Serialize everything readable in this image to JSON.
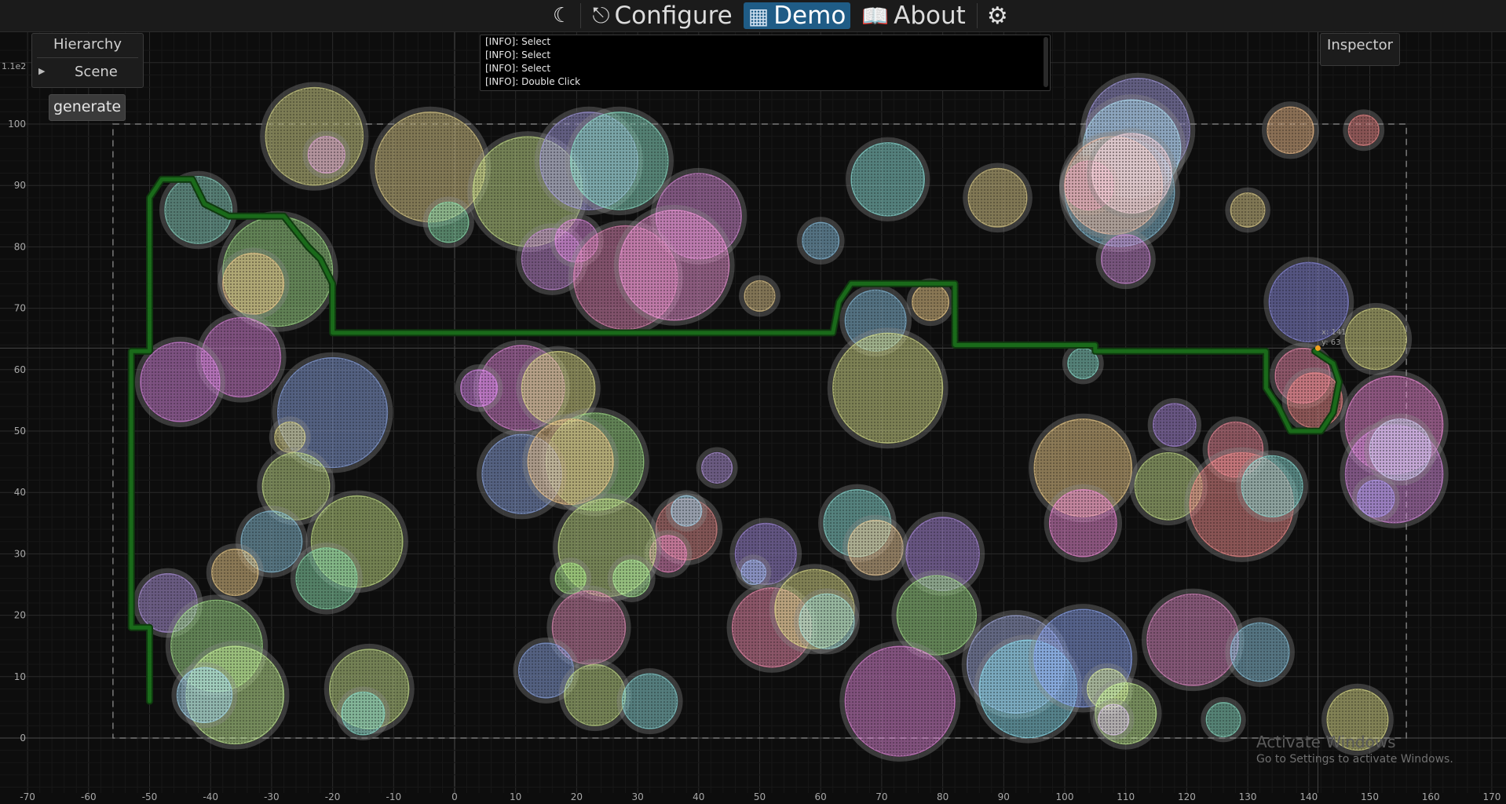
{
  "topbar": {
    "theme_icon": "moon-icon",
    "tabs": [
      {
        "label": "Configure",
        "icon": "hierarchy-icon",
        "active": false
      },
      {
        "label": "Demo",
        "icon": "app-logo-icon",
        "active": true
      },
      {
        "label": "About",
        "icon": "book-icon",
        "active": false
      }
    ],
    "settings_icon": "gear-icon",
    "active_color": "#1f5c86"
  },
  "hierarchy": {
    "title": "Hierarchy",
    "items": [
      {
        "label": "Scene",
        "icon": "collapse-triangle-icon"
      }
    ]
  },
  "generate_label": "generate",
  "inspector": {
    "title": "Inspector"
  },
  "log": {
    "lines": [
      "[INFO]: Select",
      "[INFO]: Select",
      "[INFO]: Select",
      "[INFO]: Double Click"
    ]
  },
  "plot": {
    "y_exponent_label": "1.1e2",
    "x_ticks": [
      -70,
      -60,
      -50,
      -40,
      -30,
      -20,
      -10,
      0,
      10,
      20,
      30,
      40,
      50,
      60,
      70,
      80,
      90,
      100,
      110,
      120,
      130,
      140,
      150,
      160,
      170
    ],
    "y_ticks": [
      0,
      10,
      20,
      30,
      40,
      50,
      60,
      70,
      80,
      90,
      100
    ],
    "bounds_rect": {
      "x": [
        -56,
        156
      ],
      "y": [
        0,
        100
      ]
    },
    "cursor": {
      "x": 141.5,
      "y": 63.5,
      "color": "#f0a020"
    },
    "cursor_readout": {
      "x_text": "x: 141",
      "y_text": "y: 63"
    },
    "path_color": "#1a6a1a",
    "path": [
      [
        -50,
        6
      ],
      [
        -50,
        18
      ],
      [
        -53,
        18
      ],
      [
        -53,
        63
      ],
      [
        -50,
        63
      ],
      [
        -50,
        88
      ],
      [
        -48,
        91
      ],
      [
        -43,
        91
      ],
      [
        -41,
        87
      ],
      [
        -37,
        85
      ],
      [
        -28,
        85
      ],
      [
        -24,
        80
      ],
      [
        -22,
        78
      ],
      [
        -20,
        74
      ],
      [
        -20,
        66
      ],
      [
        62,
        66
      ],
      [
        63,
        71
      ],
      [
        65,
        74
      ],
      [
        82,
        74
      ],
      [
        82,
        64
      ],
      [
        105,
        64
      ],
      [
        105,
        63
      ],
      [
        133,
        63
      ],
      [
        133,
        57
      ],
      [
        135,
        54
      ],
      [
        137,
        50
      ],
      [
        142,
        50
      ],
      [
        144,
        53
      ],
      [
        145,
        58
      ],
      [
        144,
        61
      ],
      [
        141,
        63
      ]
    ],
    "circles": [
      {
        "x": -23,
        "y": 98,
        "r": 8,
        "color": "#d8d990"
      },
      {
        "x": -21,
        "y": 95,
        "r": 3,
        "color": "#e0a8d8"
      },
      {
        "x": -42,
        "y": 86,
        "r": 5.5,
        "color": "#8fd6c4"
      },
      {
        "x": -29,
        "y": 76,
        "r": 9,
        "color": "#a6e08f"
      },
      {
        "x": -33,
        "y": 74,
        "r": 5,
        "color": "#f0c890"
      },
      {
        "x": -35,
        "y": 62,
        "r": 6.5,
        "color": "#d987d8"
      },
      {
        "x": -45,
        "y": 58,
        "r": 6.5,
        "color": "#d98ae0"
      },
      {
        "x": -20,
        "y": 53,
        "r": 9,
        "color": "#8ea6e0"
      },
      {
        "x": -27,
        "y": 49,
        "r": 2.5,
        "color": "#e0d890"
      },
      {
        "x": -26,
        "y": 41,
        "r": 5.5,
        "color": "#c8e08f"
      },
      {
        "x": -16,
        "y": 32,
        "r": 7.5,
        "color": "#c6e08a"
      },
      {
        "x": -30,
        "y": 32,
        "r": 5,
        "color": "#8ec2d8"
      },
      {
        "x": -21,
        "y": 26,
        "r": 5,
        "color": "#90e0b0"
      },
      {
        "x": -36,
        "y": 27,
        "r": 3.8,
        "color": "#f0d090"
      },
      {
        "x": -47,
        "y": 22,
        "r": 4.8,
        "color": "#b59ae0"
      },
      {
        "x": -39,
        "y": 15,
        "r": 7.5,
        "color": "#a6e08f"
      },
      {
        "x": -36,
        "y": 7,
        "r": 8,
        "color": "#c8f09a"
      },
      {
        "x": -41,
        "y": 7,
        "r": 4.5,
        "color": "#a8d8f0"
      },
      {
        "x": -14,
        "y": 8,
        "r": 6.5,
        "color": "#c8e08f"
      },
      {
        "x": -15,
        "y": 4,
        "r": 3.5,
        "color": "#90e0d0"
      },
      {
        "x": -4,
        "y": 93,
        "r": 9,
        "color": "#e0d090"
      },
      {
        "x": -1,
        "y": 84,
        "r": 3.3,
        "color": "#90e0b0"
      },
      {
        "x": 12,
        "y": 89,
        "r": 9,
        "color": "#c8e08f"
      },
      {
        "x": 22,
        "y": 94,
        "r": 8,
        "color": "#a8a0e0"
      },
      {
        "x": 27,
        "y": 94,
        "r": 8,
        "color": "#90e0c8"
      },
      {
        "x": 40,
        "y": 85,
        "r": 7,
        "color": "#d890d8"
      },
      {
        "x": 16,
        "y": 78,
        "r": 5,
        "color": "#c890d8"
      },
      {
        "x": 20,
        "y": 81,
        "r": 3.5,
        "color": "#e090e0"
      },
      {
        "x": 28,
        "y": 75,
        "r": 8.5,
        "color": "#e08ab8"
      },
      {
        "x": 36,
        "y": 77,
        "r": 9,
        "color": "#f09ad8"
      },
      {
        "x": 50,
        "y": 72,
        "r": 2.5,
        "color": "#e0c890"
      },
      {
        "x": 60,
        "y": 81,
        "r": 3,
        "color": "#8ec2e0"
      },
      {
        "x": 71,
        "y": 91,
        "r": 6,
        "color": "#90e0d8"
      },
      {
        "x": 89,
        "y": 88,
        "r": 4.8,
        "color": "#e0d090"
      },
      {
        "x": 78,
        "y": 71,
        "r": 3,
        "color": "#f0d090"
      },
      {
        "x": 69,
        "y": 68,
        "r": 5,
        "color": "#8ec2e0"
      },
      {
        "x": 71,
        "y": 57,
        "r": 9,
        "color": "#d8e08f"
      },
      {
        "x": 11,
        "y": 57,
        "r": 7,
        "color": "#e08ad8"
      },
      {
        "x": 4,
        "y": 57,
        "r": 3,
        "color": "#e090f0"
      },
      {
        "x": 17,
        "y": 57,
        "r": 6,
        "color": "#e0e090"
      },
      {
        "x": 23,
        "y": 45,
        "r": 8,
        "color": "#a6e08f"
      },
      {
        "x": 11,
        "y": 43,
        "r": 6.5,
        "color": "#90a8e0"
      },
      {
        "x": 19,
        "y": 45,
        "r": 7,
        "color": "#f0c890"
      },
      {
        "x": 43,
        "y": 44,
        "r": 2.5,
        "color": "#b89ae0"
      },
      {
        "x": 38,
        "y": 34,
        "r": 5,
        "color": "#e09090"
      },
      {
        "x": 38,
        "y": 37,
        "r": 2.5,
        "color": "#a8d8f0"
      },
      {
        "x": 35,
        "y": 30,
        "r": 3,
        "color": "#f090c8"
      },
      {
        "x": 25,
        "y": 31,
        "r": 8,
        "color": "#c8e08f"
      },
      {
        "x": 19,
        "y": 26,
        "r": 2.5,
        "color": "#b0f090"
      },
      {
        "x": 29,
        "y": 26,
        "r": 3,
        "color": "#b0f0a0"
      },
      {
        "x": 22,
        "y": 18,
        "r": 6,
        "color": "#e090b8"
      },
      {
        "x": 15,
        "y": 11,
        "r": 4.5,
        "color": "#8ea6e0"
      },
      {
        "x": 23,
        "y": 7,
        "r": 5,
        "color": "#c8e08f"
      },
      {
        "x": 32,
        "y": 6,
        "r": 4.5,
        "color": "#90d8d8"
      },
      {
        "x": 51,
        "y": 30,
        "r": 5,
        "color": "#a890e0"
      },
      {
        "x": 49,
        "y": 27,
        "r": 2,
        "color": "#a8c0f0"
      },
      {
        "x": 52,
        "y": 18,
        "r": 6.5,
        "color": "#f090b0"
      },
      {
        "x": 59,
        "y": 21,
        "r": 6.5,
        "color": "#e0e090"
      },
      {
        "x": 61,
        "y": 19,
        "r": 4.5,
        "color": "#a8e0d8"
      },
      {
        "x": 66,
        "y": 35,
        "r": 5.5,
        "color": "#90e0d8"
      },
      {
        "x": 69,
        "y": 31,
        "r": 4.5,
        "color": "#f0d0a0"
      },
      {
        "x": 80,
        "y": 30,
        "r": 6,
        "color": "#b090e0"
      },
      {
        "x": 79,
        "y": 20,
        "r": 6.5,
        "color": "#a6e08f"
      },
      {
        "x": 73,
        "y": 6,
        "r": 9,
        "color": "#e08ad8"
      },
      {
        "x": 92,
        "y": 12,
        "r": 8,
        "color": "#a8b0e0"
      },
      {
        "x": 94,
        "y": 8,
        "r": 8,
        "color": "#90e0f0"
      },
      {
        "x": 103,
        "y": 13,
        "r": 8,
        "color": "#90a8f0"
      },
      {
        "x": 107,
        "y": 8,
        "r": 3.3,
        "color": "#e0f0a0"
      },
      {
        "x": 110,
        "y": 4,
        "r": 5,
        "color": "#c8f09a"
      },
      {
        "x": 108,
        "y": 3,
        "r": 2.5,
        "color": "#e0c8f0"
      },
      {
        "x": 121,
        "y": 16,
        "r": 7.5,
        "color": "#e090c8"
      },
      {
        "x": 132,
        "y": 14,
        "r": 4.8,
        "color": "#90c8e0"
      },
      {
        "x": 126,
        "y": 3,
        "r": 2.8,
        "color": "#90e0c8"
      },
      {
        "x": 148,
        "y": 3,
        "r": 5,
        "color": "#e0e090"
      },
      {
        "x": 103,
        "y": 44,
        "r": 8,
        "color": "#f0d090"
      },
      {
        "x": 103,
        "y": 35,
        "r": 5.5,
        "color": "#f090d8"
      },
      {
        "x": 118,
        "y": 51,
        "r": 3.5,
        "color": "#b090e0"
      },
      {
        "x": 117,
        "y": 41,
        "r": 5.5,
        "color": "#c8e08f"
      },
      {
        "x": 128,
        "y": 47,
        "r": 4.5,
        "color": "#f090a0"
      },
      {
        "x": 129,
        "y": 38,
        "r": 8.5,
        "color": "#f09090"
      },
      {
        "x": 134,
        "y": 41,
        "r": 5,
        "color": "#90e0d8"
      },
      {
        "x": 103,
        "y": 61,
        "r": 2.5,
        "color": "#90e0d0"
      },
      {
        "x": 140,
        "y": 71,
        "r": 6.5,
        "color": "#9090e0"
      },
      {
        "x": 151,
        "y": 65,
        "r": 5,
        "color": "#e0e090"
      },
      {
        "x": 139,
        "y": 59,
        "r": 4.5,
        "color": "#f090b0"
      },
      {
        "x": 141,
        "y": 55,
        "r": 4.5,
        "color": "#f09090"
      },
      {
        "x": 154,
        "y": 51,
        "r": 8,
        "color": "#f090d8"
      },
      {
        "x": 154,
        "y": 43,
        "r": 8,
        "color": "#d890e0"
      },
      {
        "x": 155,
        "y": 47,
        "r": 5,
        "color": "#d0d0f0"
      },
      {
        "x": 151,
        "y": 39,
        "r": 3,
        "color": "#b0a0f0"
      },
      {
        "x": 112,
        "y": 99,
        "r": 8.5,
        "color": "#a8a0e0"
      },
      {
        "x": 111,
        "y": 96,
        "r": 8,
        "color": "#b0e0f0"
      },
      {
        "x": 109,
        "y": 89,
        "r": 9,
        "color": "#90c8e0"
      },
      {
        "x": 104,
        "y": 90,
        "r": 4,
        "color": "#f090d8"
      },
      {
        "x": 108,
        "y": 90,
        "r": 8,
        "color": "#f0c0a8"
      },
      {
        "x": 111,
        "y": 92,
        "r": 6.5,
        "color": "#f0d0d8"
      },
      {
        "x": 110,
        "y": 78,
        "r": 4,
        "color": "#d090d8"
      },
      {
        "x": 137,
        "y": 99,
        "r": 3.8,
        "color": "#f0c090"
      },
      {
        "x": 149,
        "y": 99,
        "r": 2.5,
        "color": "#f09090"
      },
      {
        "x": 130,
        "y": 86,
        "r": 2.8,
        "color": "#e0d090"
      }
    ]
  }
}
